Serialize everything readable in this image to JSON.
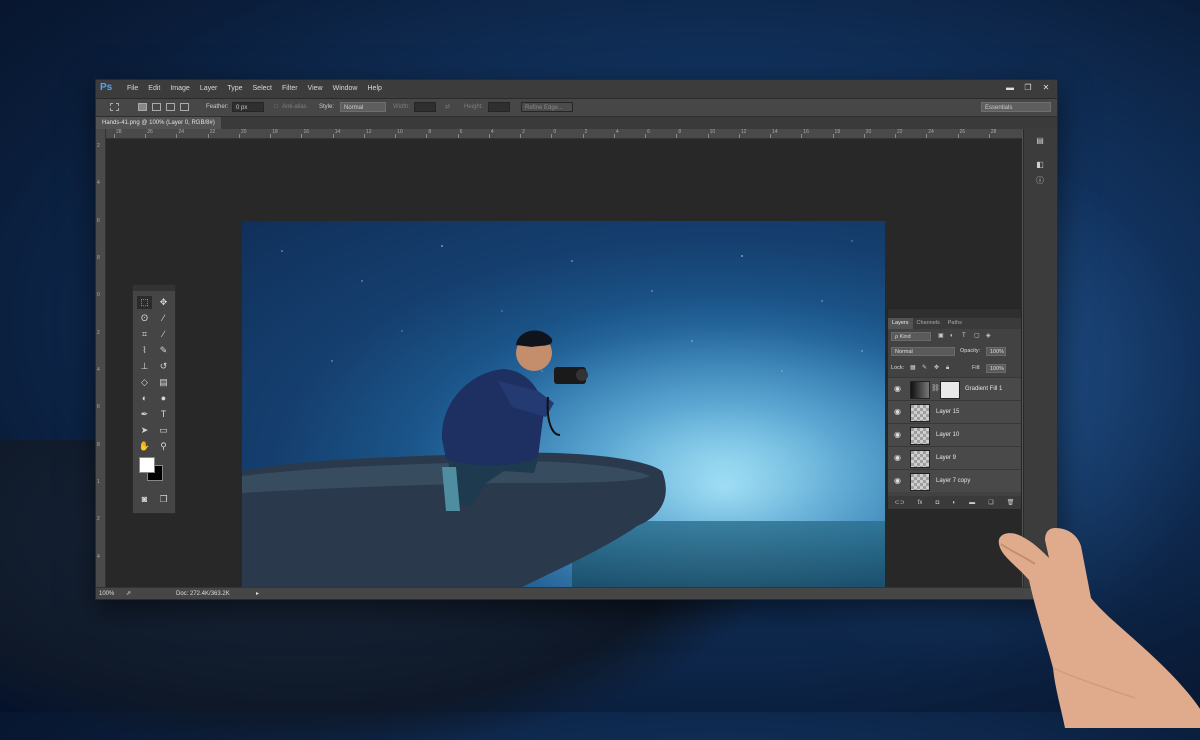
{
  "menubar": {
    "logo": "Ps",
    "items": [
      "File",
      "Edit",
      "Image",
      "Layer",
      "Type",
      "Select",
      "Filter",
      "View",
      "Window",
      "Help"
    ],
    "window_controls": [
      "minimize-icon",
      "restore-icon",
      "close-icon"
    ]
  },
  "options_bar": {
    "feather_label": "Feather:",
    "feather_value": "0 px",
    "anti_alias_label": "Anti-alias",
    "style_label": "Style:",
    "style_value": "Normal",
    "width_label": "Width:",
    "height_label": "Height:",
    "refine_edge_label": "Refine Edge...",
    "workspace_value": "Essentials"
  },
  "document": {
    "tab_title": "Hands-41.png @ 100% (Layer 0, RGB/8#)"
  },
  "rulers": {
    "top_labels": [
      "28",
      "26",
      "24",
      "22",
      "20",
      "18",
      "16",
      "14",
      "12",
      "10",
      "8",
      "6",
      "4",
      "2",
      "0",
      "2",
      "4",
      "6",
      "8",
      "10",
      "12",
      "14",
      "16",
      "18",
      "20",
      "22",
      "24",
      "26",
      "28"
    ],
    "left_labels": [
      "2",
      "4",
      "6",
      "8",
      "0",
      "2",
      "4",
      "6",
      "8",
      "1",
      "2",
      "4"
    ]
  },
  "toolbox": {
    "tools": [
      "marquee-icon",
      "move-icon",
      "lasso-icon",
      "quick-select-icon",
      "crop-icon",
      "eyedropper-icon",
      "healing-brush-icon",
      "brush-icon",
      "clone-stamp-icon",
      "history-brush-icon",
      "eraser-icon",
      "gradient-icon",
      "blur-icon",
      "dodge-icon",
      "pen-icon",
      "type-icon",
      "path-select-icon",
      "rectangle-icon",
      "hand-icon",
      "zoom-icon"
    ],
    "foreground_color": "#ffffff",
    "background_color": "#000000"
  },
  "layers_panel": {
    "tabs": [
      "Layers",
      "Channels",
      "Paths"
    ],
    "kind_filter": "ρ Kind",
    "blend_mode": "Normal",
    "opacity_label": "Opacity:",
    "opacity_value": "100%",
    "lock_label": "Lock:",
    "fill_label": "Fill:",
    "fill_value": "100%",
    "layers": [
      {
        "name": "Gradient Fill 1",
        "type": "gradient"
      },
      {
        "name": "Layer 15",
        "type": "pixel"
      },
      {
        "name": "Layer 10",
        "type": "pixel"
      },
      {
        "name": "Layer 9",
        "type": "pixel"
      },
      {
        "name": "Layer 7 copy",
        "type": "pixel"
      }
    ],
    "footer_icons": [
      "link-icon",
      "fx-icon",
      "mask-icon",
      "adjustment-icon",
      "group-icon",
      "new-layer-icon",
      "trash-icon"
    ]
  },
  "status_bar": {
    "zoom": "100%",
    "doc_size": "Doc: 272.4K/363.2K"
  },
  "colors": {
    "photoshop_accent": "#4aa5ff",
    "panel_bg": "#535353",
    "canvas_bg": "#282828"
  }
}
